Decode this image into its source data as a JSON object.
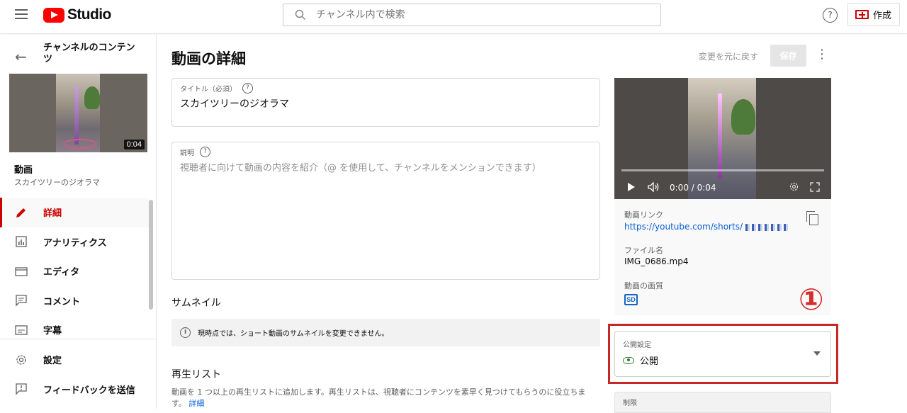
{
  "app": {
    "logo_text": "Studio",
    "search_placeholder": "チャンネル内で検索",
    "help_glyph": "?",
    "create_label": "作成"
  },
  "sidebar": {
    "title": "チャンネルのコンテンツ",
    "thumbnail_duration": "0:04",
    "video_label": "動画",
    "video_title": "スカイツリーのジオラマ",
    "nav_items": [
      {
        "label": "詳細",
        "icon": "pencil-icon",
        "active": true
      },
      {
        "label": "アナリティクス",
        "icon": "analytics-icon",
        "active": false
      },
      {
        "label": "エディタ",
        "icon": "editor-icon",
        "active": false
      },
      {
        "label": "コメント",
        "icon": "comment-icon",
        "active": false
      },
      {
        "label": "字幕",
        "icon": "subtitles-icon",
        "active": false
      }
    ],
    "footer_items": [
      {
        "label": "設定",
        "icon": "gear-icon"
      },
      {
        "label": "フィードバックを送信",
        "icon": "feedback-icon"
      }
    ]
  },
  "main": {
    "page_title": "動画の詳細",
    "undo_label": "変更を元に戻す",
    "save_label": "保存",
    "title_field": {
      "label": "タイトル（必須）",
      "value": "スカイツリーのジオラマ"
    },
    "description_field": {
      "label": "説明",
      "placeholder": "視聴者に向けて動画の内容を紹介（@ を使用して、チャンネルをメンションできます）"
    },
    "thumbnail_section": {
      "title": "サムネイル",
      "notice": "現時点では、ショート動画のサムネイルを変更できません。"
    },
    "playlist_section": {
      "title": "再生リスト",
      "description": "動画を 1 つ以上の再生リストに追加します。再生リストは、視聴者にコンテンツを素早く見つけてもらうのに役立ちます。",
      "details_link": "詳細"
    }
  },
  "right_panel": {
    "player_time": "0:00 / 0:04",
    "video_link_label": "動画リンク",
    "video_link_url": "https://youtube.com/shorts/",
    "filename_label": "ファイル名",
    "filename": "IMG_0686.mp4",
    "quality_label": "動画の画質",
    "quality_badge": "SD",
    "annotation_number": "①",
    "visibility": {
      "label": "公開設定",
      "value": "公開"
    },
    "restriction_label": "制限"
  },
  "colors": {
    "accent_red": "#cc0000",
    "link_blue": "#065fd4",
    "annotation_red": "#c62828",
    "public_green": "#2e7d32"
  }
}
